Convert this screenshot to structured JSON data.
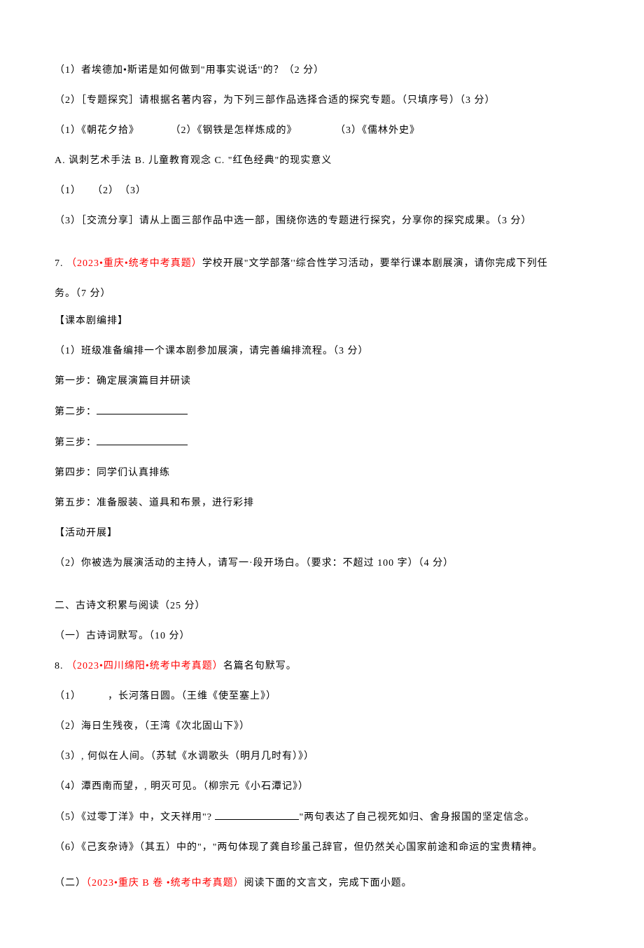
{
  "lines": {
    "l1": "（1）者埃德加•斯诺是如何做到\"用事实说话''的？（2 分）",
    "l2": "（2）［专题探究］请根据名著内容，为下列三部作品选择合适的探究专题。（只填序号）（3 分）",
    "l3a": "（1）《朝花夕拾》",
    "l3b": "（2）《钢铁是怎样炼成的》",
    "l3c": "（3）《儒林外史》",
    "l4": "A. 讽刺艺术手法 B. 儿童教育观念 C. \"红色经典\"的现实意义",
    "l5": "（1）　　（2）　（3）",
    "l6": "（3）［交流分享］请从上面三部作品中选一部，围绕你选的专题进行探究，分享你的探究成果。（3 分）",
    "q7_num": "7. ",
    "q7_red": "（2023•重庆•统考中考真题）",
    "q7_text": "学校开展\"文学部落''综合性学习活动，要举行课本剧展演，请你完成下列任",
    "q7_text2": "务。（7 分）",
    "section1": "【课本剧编排】",
    "l8": "（1）班级准备编排一个课本剧参加展演，请完善编排流程。（3 分）",
    "step1": "第一步：确定展演篇目并研读",
    "step2": "第二步：",
    "step3": "第三步：",
    "step4": "第四步：同学们认真排练",
    "step5": "第五步：准备服装、道具和布景，进行彩排",
    "section2": "【活动开展】",
    "l9": "（2）你被选为展演活动的主持人，请写一·段开场白。（要求：不超过 100 字）（4 分）",
    "part2": "二、古诗文积累与阅读（25 分）",
    "part2_1": "（一）古诗词默写。（10 分）",
    "q8_num": "8. ",
    "q8_red": "（2023•四川绵阳•统考中考真题）",
    "q8_text": "名篇名句默写。",
    "p1": "（1）　　　，长河落日圆。（王维《使至塞上》）",
    "p2": "（2）海日生残夜，（王湾《次北固山下》）",
    "p3": "（3）, 何似在人间。（苏轼《水调歌头（明月几时有）》）",
    "p4": "（4）潭西南而望，, 明灭可见。（柳宗元《小石潭记》）",
    "p5a": "（5）《过零丁洋》中，文天祥用\"? ",
    "p5b": "\"两句表达了自己视死如归、舍身报国的坚定信念。",
    "p6": "（6）《己亥杂诗》（其五）中的\"，\"两句体现了龚自珍虽己辞官，但仍然关心国家前途和命运的宝贵精神。",
    "part2_2a": "（二）",
    "part2_2_red": "（2023•重庆 B 卷 •统考中考真题）",
    "part2_2b": "阅读下面的文言文，完成下面小题。"
  }
}
